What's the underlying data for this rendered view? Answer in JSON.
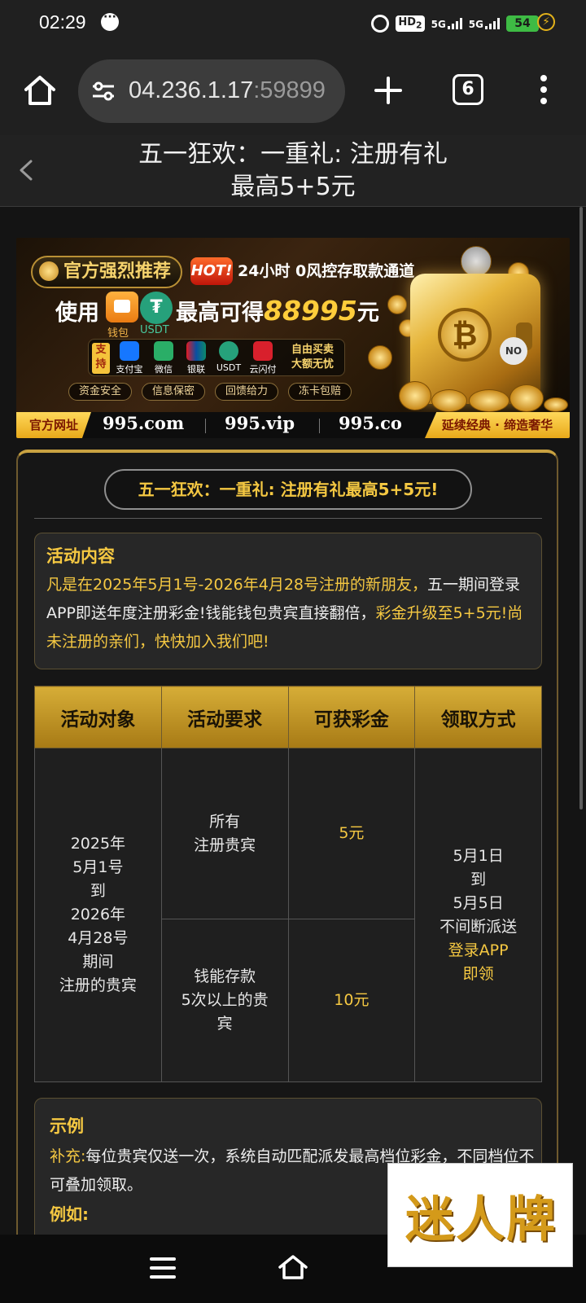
{
  "status_bar": {
    "time": "02:29",
    "hd_label": "HD",
    "hd_sub": "2",
    "signal1_label": "5G",
    "signal2_label": "5G",
    "battery": "54"
  },
  "browser": {
    "url_host": "04.236.1.17",
    "url_port": ":59899",
    "tab_count": "6"
  },
  "page_header": {
    "title_line1": "五一狂欢：一重礼: 注册有礼",
    "title_line2": "最高5+5元"
  },
  "banner": {
    "tag_recommend": "官方强烈推荐",
    "hot": "HOT!",
    "line1": "24小时 0风控存取款通道",
    "use": "使用",
    "wallet_label": "钱包",
    "usdt_label": "USDT",
    "max_prefix": "最高可得",
    "max_amount": "88995",
    "max_unit": "元",
    "support": "支持",
    "payments": [
      "支付宝",
      "微信",
      "银联",
      "USDT",
      "云闪付"
    ],
    "free_trade_1": "自由买卖",
    "free_trade_2": "大额无忧",
    "pills": [
      "资金安全",
      "信息保密",
      "回馈给力",
      "冻卡包赔"
    ],
    "official_site": "官方网址",
    "domains": [
      "995.com",
      "995.vip",
      "995.co"
    ],
    "slogan": "延续经典 · 缔造奢华",
    "no_badge": "NO"
  },
  "activity": {
    "title": "五一狂欢：一重礼: 注册有礼最高5+5元!",
    "content_heading": "活动内容",
    "content_part1": "凡是在2025年5月1号-2026年4月28号注册的新朋友，",
    "content_part2": "五一期间登录APP即送年度注册彩金!",
    "content_part3": "钱能钱包贵宾",
    "content_part4": "直接翻倍，",
    "content_part5": "彩金升级至5+5元!尚未注册的亲们，快快加入我们吧!",
    "table": {
      "headers": [
        "活动对象",
        "活动要求",
        "可获彩金",
        "领取方式"
      ],
      "target": [
        "2025年",
        "5月1号",
        "到",
        "2026年",
        "4月28号",
        "期间",
        "注册的贵宾"
      ],
      "req1": [
        "所有",
        "注册贵宾"
      ],
      "bonus1": "5元",
      "req2": [
        "钱能存款",
        "5次以上的贵",
        "宾"
      ],
      "bonus2": "10元",
      "method": [
        "5月1日",
        "到",
        "5月5日",
        "不间断派送"
      ],
      "method_gold": [
        "登录APP",
        "即领"
      ]
    },
    "example_heading": "示例",
    "supplement_label": "补充:",
    "supplement_text": "每位贵宾仅送一次，系统自动匹配派发最高档位彩金，不同档位不可叠加领取。",
    "example_label": "例如:"
  },
  "watermark": {
    "text": "迷人牌"
  },
  "icons": [
    "alarm-icon",
    "message-icon",
    "charging-icon",
    "home-icon",
    "site-info-icon",
    "plus-icon",
    "tabs-icon",
    "more-menu-icon",
    "back-icon",
    "nav-menu-icon",
    "nav-home-icon"
  ]
}
